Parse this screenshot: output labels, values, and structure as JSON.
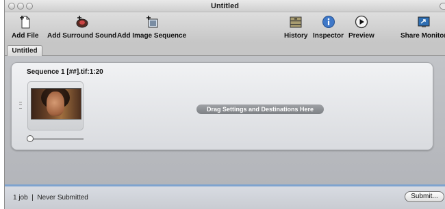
{
  "window": {
    "title": "Untitled"
  },
  "toolbar": {
    "add_file": "Add File",
    "add_surround_sound": "Add Surround Sound",
    "add_image_sequence": "Add Image Sequence",
    "history": "History",
    "inspector": "Inspector",
    "preview": "Preview",
    "share_monitor": "Share Monitor"
  },
  "tabs": [
    {
      "label": "Untitled"
    }
  ],
  "batch": {
    "sequence_title": "Sequence 1 [##].tif:1:20",
    "drop_hint": "Drag Settings and Destinations Here"
  },
  "status": {
    "summary": "1 job  |  Never Submitted",
    "submit_label": "Submit..."
  },
  "colors": {
    "status_accent": "#7ea3cf",
    "inspector_blue": "#3f78c8"
  },
  "icons": [
    "add-file-icon",
    "surround-sound-icon",
    "image-sequence-icon",
    "history-icon",
    "inspector-icon",
    "preview-icon",
    "share-monitor-icon"
  ]
}
